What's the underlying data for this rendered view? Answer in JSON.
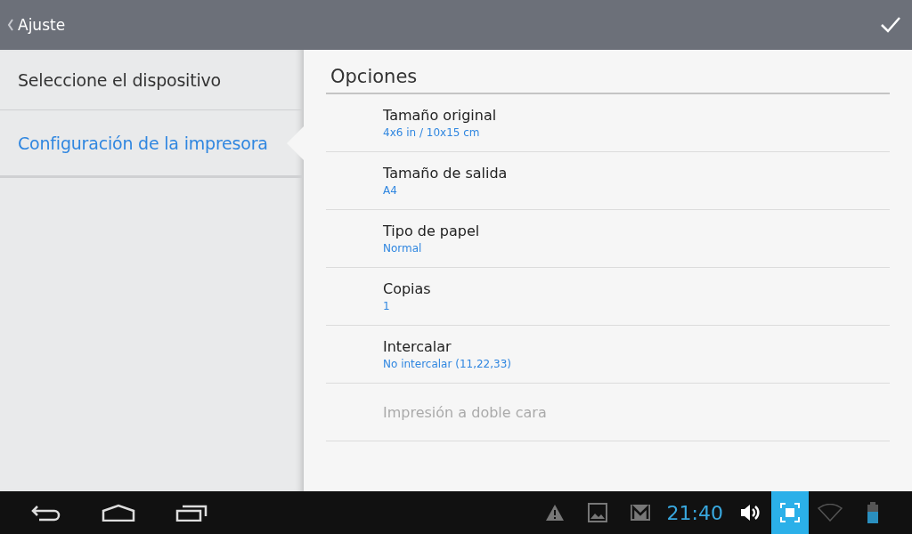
{
  "action_bar": {
    "title": "Ajuste"
  },
  "sidebar": {
    "items": [
      {
        "label": "Seleccione el dispositivo",
        "selected": false
      },
      {
        "label": "Configuración de la impresora",
        "selected": true
      }
    ]
  },
  "options": {
    "title": "Opciones",
    "items": [
      {
        "title": "Tamaño original",
        "value": "4x6 in / 10x15 cm",
        "disabled": false
      },
      {
        "title": "Tamaño de salida",
        "value": "A4",
        "disabled": false
      },
      {
        "title": "Tipo de papel",
        "value": "Normal",
        "disabled": false
      },
      {
        "title": "Copias",
        "value": "1",
        "disabled": false
      },
      {
        "title": "Intercalar",
        "value": "No intercalar (11,22,33)",
        "disabled": false
      },
      {
        "title": "Impresión a doble cara",
        "disabled": true
      }
    ]
  },
  "system_bar": {
    "time": "21:40"
  }
}
